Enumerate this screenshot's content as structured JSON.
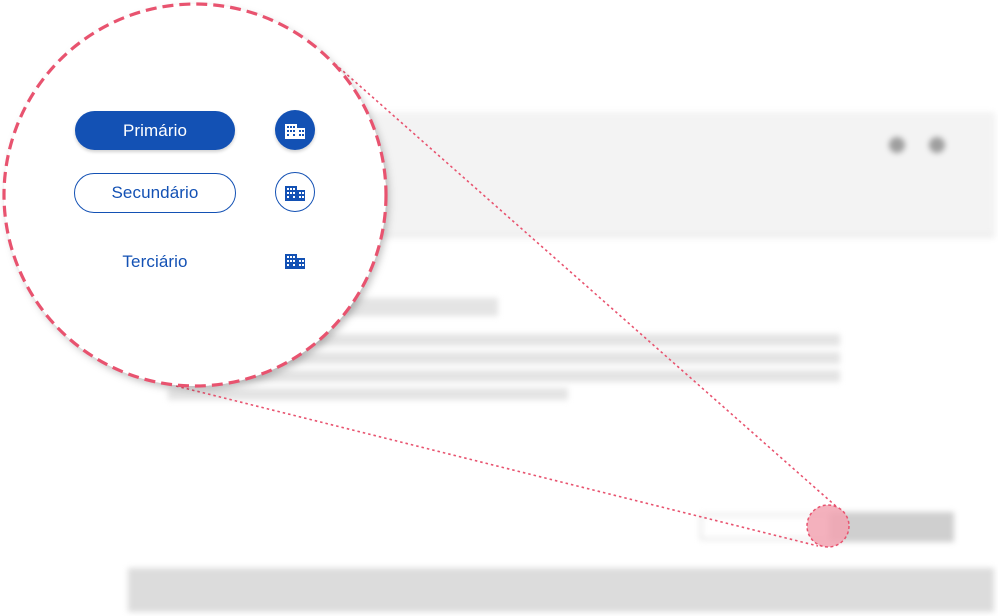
{
  "buttons": {
    "primary_label": "Primário",
    "secondary_label": "Secundário",
    "tertiary_label": "Terciário"
  },
  "icons": {
    "primary": "building-icon",
    "secondary": "building-icon",
    "tertiary": "building-icon"
  },
  "colors": {
    "brand_blue": "#1351b4",
    "highlight_pink": "#e8536f"
  }
}
